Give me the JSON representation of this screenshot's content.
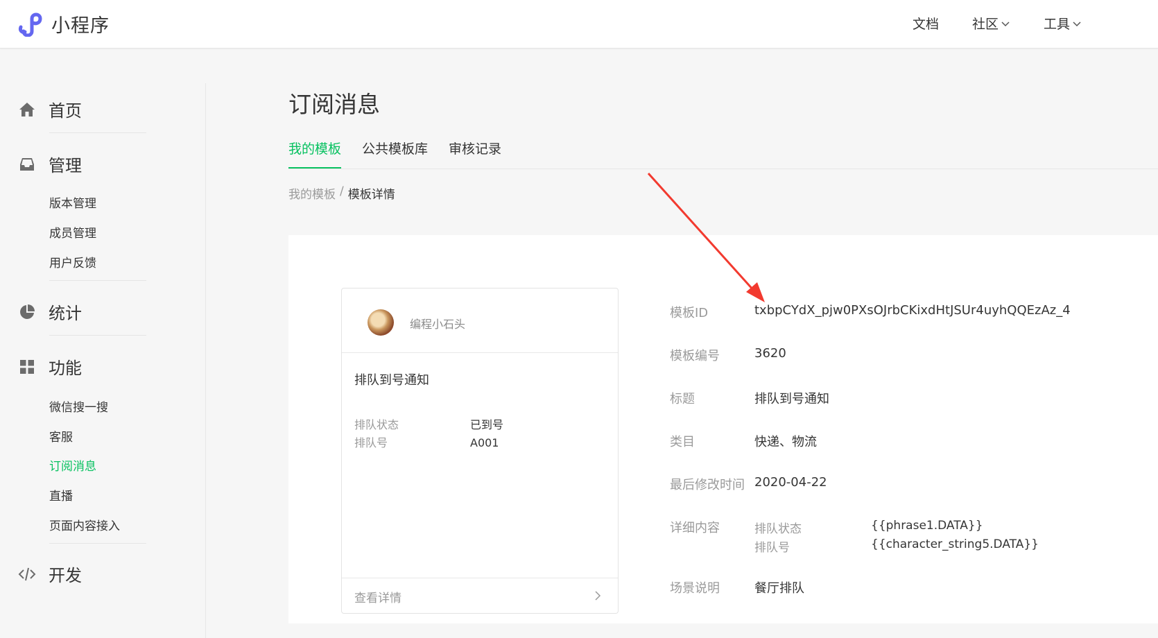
{
  "header": {
    "logo_text": "小程序",
    "nav": [
      {
        "label": "文档"
      },
      {
        "label": "社区"
      },
      {
        "label": "工具"
      }
    ]
  },
  "sidebar": {
    "groups": [
      {
        "label": "首页",
        "icon": "home-icon"
      },
      {
        "label": "管理",
        "icon": "inbox-icon"
      },
      {
        "label": "统计",
        "icon": "pie-chart-icon"
      },
      {
        "label": "功能",
        "icon": "grid-icon"
      },
      {
        "label": "开发",
        "icon": "code-icon"
      }
    ],
    "manage_items": [
      "版本管理",
      "成员管理",
      "用户反馈"
    ],
    "feature_items": [
      "微信搜一搜",
      "客服",
      "订阅消息",
      "直播",
      "页面内容接入"
    ],
    "active_item": "订阅消息"
  },
  "main": {
    "title": "订阅消息",
    "tabs": [
      {
        "label": "我的模板",
        "active": true
      },
      {
        "label": "公共模板库",
        "active": false
      },
      {
        "label": "审核记录",
        "active": false
      }
    ],
    "breadcrumb": {
      "parent": "我的模板",
      "separator": "/",
      "current": "模板详情"
    }
  },
  "preview_card": {
    "account_name": "编程小石头",
    "title": "排队到号通知",
    "fields": [
      {
        "key": "排队状态",
        "value": "已到号"
      },
      {
        "key": "排队号",
        "value": "A001"
      }
    ],
    "footer_link": "查看详情"
  },
  "details": {
    "template_id_label": "模板ID",
    "template_id": "txbpCYdX_pjw0PXsOJrbCKixdHtJSUr4uyhQQEzAz_4",
    "number_label": "模板编号",
    "number": "3620",
    "title_label": "标题",
    "title": "排队到号通知",
    "category_label": "类目",
    "category": "快递、物流",
    "modified_label": "最后修改时间",
    "modified": "2020-04-22",
    "content_label": "详细内容",
    "content": [
      {
        "key": "排队状态",
        "value": "{{phrase1.DATA}}"
      },
      {
        "key": "排队号",
        "value": "{{character_string5.DATA}}"
      }
    ],
    "scene_label": "场景说明",
    "scene": "餐厅排队"
  },
  "colors": {
    "accent": "#07c160",
    "annotation_arrow": "#f23a2f",
    "logo": "#6467f0"
  }
}
